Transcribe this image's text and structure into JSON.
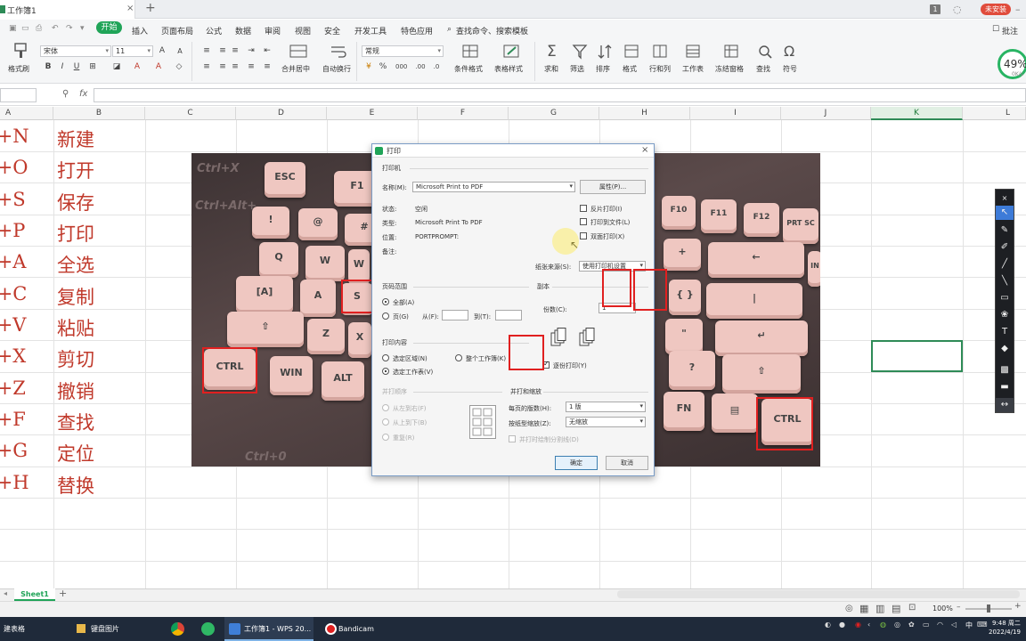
{
  "titlebar": {
    "doc_title": "工作簿1",
    "unsafe_label": "未安装"
  },
  "menu": {
    "start": "开始",
    "items": [
      "插入",
      "页面布局",
      "公式",
      "数据",
      "审阅",
      "视图",
      "安全",
      "开发工具",
      "特色应用"
    ],
    "search": "查找命令、搜索模板",
    "comment": "批注"
  },
  "ribbon": {
    "format_painter": "格式刷",
    "font_name": "宋体",
    "font_size": "11",
    "merge_center": "合并居中",
    "wrap": "自动换行",
    "number_format": "常规",
    "conditional": "条件格式",
    "table_style": "表格样式",
    "sum": "求和",
    "filter": "筛选",
    "sort": "排序",
    "format": "格式",
    "row_col": "行和列",
    "worksheet": "工作表",
    "freeze": "冻结窗格",
    "find": "查找",
    "symbol": "符号",
    "speed_value": "49%",
    "speed_sub": "0K/s"
  },
  "formula": {
    "fx": "fx"
  },
  "columns": [
    "A",
    "B",
    "C",
    "D",
    "E",
    "F",
    "G",
    "H",
    "I",
    "J",
    "K",
    "L"
  ],
  "shortcuts": [
    {
      "key": "l+N",
      "label": "新建"
    },
    {
      "key": "l+O",
      "label": "打开"
    },
    {
      "key": "l+S",
      "label": "保存"
    },
    {
      "key": "l+P",
      "label": "打印"
    },
    {
      "key": "l+A",
      "label": "全选"
    },
    {
      "key": "l+C",
      "label": "复制"
    },
    {
      "key": "l+V",
      "label": "粘贴"
    },
    {
      "key": "l+X",
      "label": "剪切"
    },
    {
      "key": "l+Z",
      "label": "撤销"
    },
    {
      "key": "l+F",
      "label": "查找"
    },
    {
      "key": "l+G",
      "label": "定位"
    },
    {
      "key": "l+H",
      "label": "替换"
    }
  ],
  "photo": {
    "keys": {
      "esc": "ESC",
      "f1": "F1",
      "s": "S",
      "a": "[A]",
      "q": "Q",
      "w": "W",
      "z": "Z",
      "x": "X",
      "ctrl_left": "CTRL",
      "win": "WIN",
      "alt": "ALT",
      "f10": "F10",
      "f11": "F11",
      "f12": "F12",
      "prtsc": "PRT SC",
      "fn": "FN",
      "ctrl_right": "CTRL",
      "brace": "{ }",
      "in": "IN"
    },
    "bg_text": [
      "Ctrl+X",
      "Ctrl+Alt+",
      "Ctrl+0"
    ]
  },
  "dialog": {
    "title": "打印",
    "printer_group": "打印机",
    "name_label": "名称(M):",
    "name_value": "Microsoft Print to PDF",
    "properties_btn": "属性(P)...",
    "status_label": "状态:",
    "status_value": "空闲",
    "type_label": "类型:",
    "type_value": "Microsoft Print To PDF",
    "where_label": "位置:",
    "where_value": "PORTPROMPT:",
    "comment_label": "备注:",
    "reverse": "反片打印(I)",
    "to_file": "打印到文件(L)",
    "duplex": "双面打印(X)",
    "paper_source_label": "纸张来源(S):",
    "paper_source_value": "使用打印机设置",
    "range_group": "页码范围",
    "all": "全部(A)",
    "pages": "页(G)",
    "from": "从(F):",
    "to": "到(T):",
    "copies_group": "副本",
    "copies_label": "份数(C):",
    "copies_value": "1",
    "content_group": "打印内容",
    "selection": "选定区域(N)",
    "whole_book": "整个工作簿(K)",
    "active_sheet": "选定工作表(V)",
    "collate": "逐份打印(Y)",
    "order_group": "并打顺序",
    "left_right": "从左到右(F)",
    "top_bottom": "从上到下(B)",
    "repeat": "重复(R)",
    "scale_group": "并打和缩放",
    "pages_per_sheet_label": "每页的版数(H):",
    "pages_per_sheet_value": "1 版",
    "scale_label": "按纸型缩放(Z):",
    "scale_value": "无缩放",
    "draw_border": "并打时绘制分割线(D)",
    "ok": "确定",
    "cancel": "取消"
  },
  "sheetbar": {
    "tab": "Sheet1",
    "zoom": "100%"
  },
  "taskbar": {
    "items": [
      "建表格",
      "键盘图片",
      "工作簿1 - WPS 20...",
      "Bandicam"
    ],
    "time": "9:48 周二",
    "date": "2022/4/19"
  }
}
